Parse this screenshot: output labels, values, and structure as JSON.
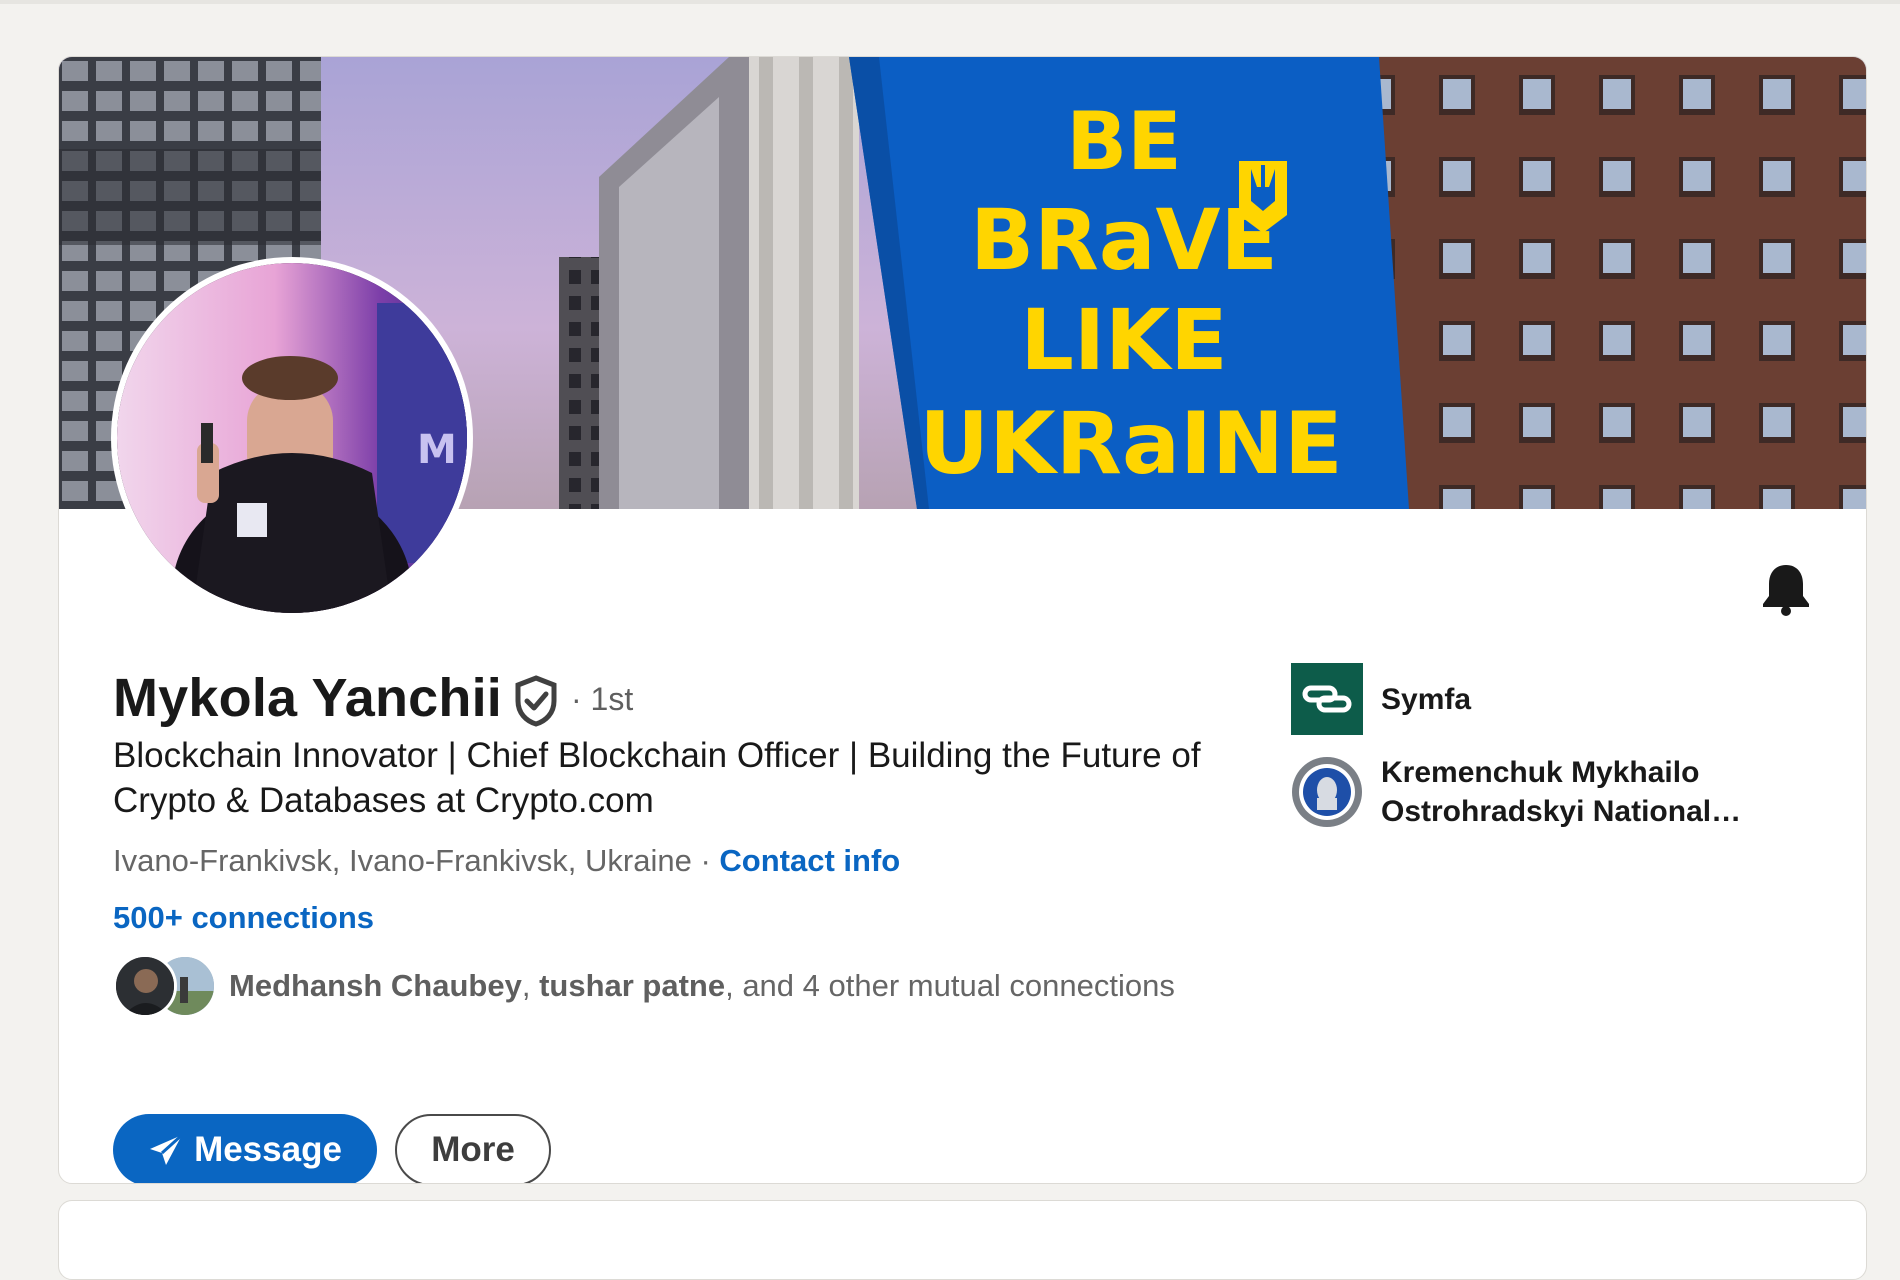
{
  "profile": {
    "name": "Mykola Yanchii",
    "degree": "· 1st",
    "headline": "Blockchain Innovator | Chief Blockchain Officer | Building the Future of Crypto & Databases at Crypto.com",
    "location": "Ivano-Frankivsk, Ivano-Frankivsk, Ukraine",
    "separator": " · ",
    "contact_label": "Contact info",
    "connections": "500+ connections"
  },
  "banner": {
    "sign_lines": [
      "BE",
      "BRaVE",
      "LIKE",
      "UKRaINE"
    ],
    "colors": {
      "sign_bg": "#0b5ec4",
      "sign_text": "#ffd500"
    }
  },
  "mutual": {
    "name1": "Medhansh Chaubey",
    "sep": ", ",
    "name2": "tushar patne",
    "rest": ", and 4 other mutual connections"
  },
  "actions": {
    "message_label": "Message",
    "more_label": "More"
  },
  "sidebar": {
    "items": [
      {
        "label": "Symfa",
        "icon": "symfa-logo"
      },
      {
        "label": "Kremenchuk Mykhailo Ostrohradskyi National…",
        "icon": "university-logo"
      }
    ]
  },
  "icons": {
    "notify": "bell-icon",
    "verified": "verified-shield-icon",
    "send": "paper-plane-icon"
  },
  "colors": {
    "accent": "#0a66c2",
    "page_bg": "#f3f2ef",
    "text": "#191919",
    "muted": "#666666"
  }
}
